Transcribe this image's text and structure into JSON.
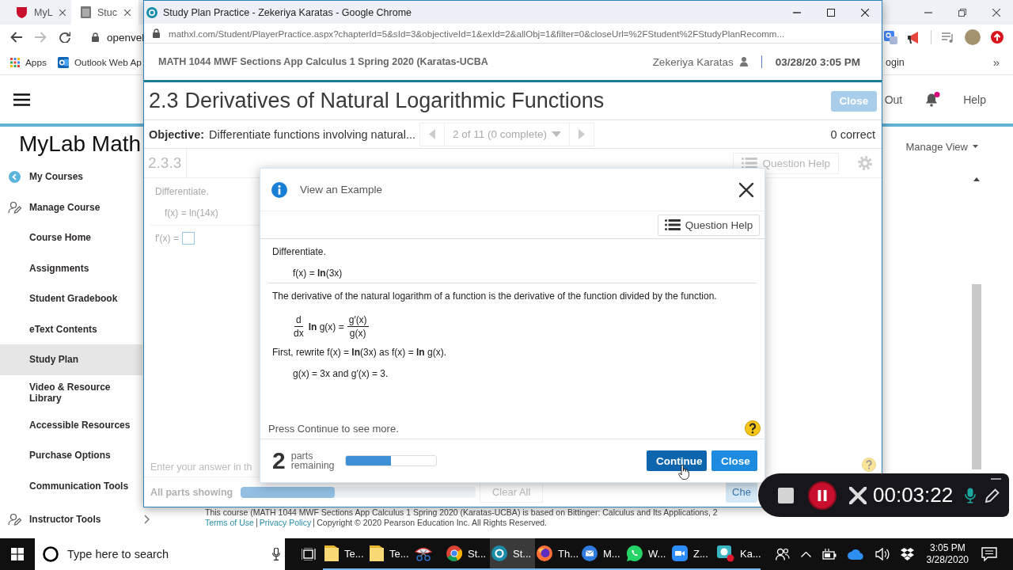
{
  "browser": {
    "tabs": [
      {
        "kind": "shield",
        "label": "MyL",
        "selected": false
      },
      {
        "kind": "page",
        "label": "Stuc",
        "selected": true
      }
    ],
    "address": "openvel",
    "bookmarks": [
      {
        "kind": "apps",
        "label": "Apps"
      },
      {
        "kind": "mail",
        "label": "Outlook Web Ap"
      }
    ],
    "bookmarks_right": [
      {
        "label": "ogin"
      }
    ],
    "overflow": "»"
  },
  "mylab": {
    "header_items": [
      {
        "kind": "link",
        "label": "Out"
      },
      {
        "kind": "bell"
      },
      {
        "kind": "link",
        "label": "Help"
      }
    ],
    "brand": "MyLab Math",
    "sidebar": [
      {
        "kind": "back",
        "label": "My Courses",
        "selected": false
      },
      {
        "kind": "tool",
        "label": "Manage Course",
        "selected": false
      },
      {
        "kind": "link",
        "label": "Course Home",
        "selected": false
      },
      {
        "kind": "link",
        "label": "Assignments",
        "selected": false
      },
      {
        "kind": "link",
        "label": "Student Gradebook",
        "selected": false
      },
      {
        "kind": "link",
        "label": "eText Contents",
        "selected": false
      },
      {
        "kind": "link",
        "label": "Study Plan",
        "selected": true
      },
      {
        "kind": "link",
        "label": "Video & Resource Library",
        "selected": false
      },
      {
        "kind": "link",
        "label": "Accessible Resources",
        "selected": false
      },
      {
        "kind": "link",
        "label": "Purchase Options",
        "selected": false
      },
      {
        "kind": "link",
        "label": "Communication Tools",
        "selected": false
      },
      {
        "kind": "tool_menu",
        "label": "Instructor Tools",
        "selected": false
      }
    ],
    "manage_view": "Manage View",
    "footer": {
      "note": "This course (MATH 1044 MWF Sections App Calculus 1 Spring 2020 (Karatas-UCBA) is based on Bittinger: Calculus and Its Applications, 2",
      "links": [
        "Terms of Use",
        "Privacy Policy"
      ],
      "copyright": "Copyright © 2020 Pearson Education Inc. All Rights Reserved."
    }
  },
  "popup": {
    "title": "Study Plan Practice - Zekeriya Karatas - Google Chrome",
    "url": "mathxl.com/Student/PlayerPractice.aspx?chapterId=5&sId=3&objectiveId=1&exId=2&allObj=1&filter=0&closeUrl=%2FStudent%2FStudyPlanRecomm...",
    "course": "MATH 1044 MWF Sections App Calculus 1 Spring 2020 (Karatas-UCBA",
    "user": "Zekeriya Karatas",
    "datetime": "03/28/20 3:05 PM",
    "section_number": "2.3",
    "section_title": "Derivatives of Natural Logarithmic Functions",
    "close_button": "Close",
    "objective_label": "Objective:",
    "objective": "Differentiate functions involving natural...",
    "question_position": "2 of 11 (0 complete)",
    "score": "0 correct",
    "question_number": "2.3.3",
    "question_help": "Question Help",
    "question": {
      "prompt": "Differentiate.",
      "function": "f(x) = ln(14x)",
      "answer_label": "f′(x) ="
    },
    "instructions": "Enter your answer in th",
    "parts": {
      "label": "All parts showing",
      "level": 0.4
    },
    "clear_button": "Clear All",
    "check_button": "Che"
  },
  "dialog": {
    "title": "View an Example",
    "question_help": "Question Help",
    "problem": {
      "prompt": "Differentiate.",
      "function": "f(x) = **ln**(3x)"
    },
    "steps": [
      {
        "kind": "text",
        "text": "The derivative of the natural logarithm of a function is the derivative of the function divided by the function."
      },
      {
        "kind": "fraction",
        "lhs_numerator": "d",
        "lhs_denominator": "dx",
        "middle": "**ln** g(x) =",
        "rhs_numerator": "g′(x)",
        "rhs_denominator": "g(x)"
      },
      {
        "kind": "text",
        "text": "First, rewrite f(x) = **ln**(3x) as f(x) = **ln** g(x)."
      },
      {
        "kind": "indented",
        "text": "g(x) = 3x and g′(x) = 3."
      }
    ],
    "hint": "Press Continue to see more.",
    "parts_count": "2",
    "parts_label": "parts remaining",
    "progress": {
      "level": 0.5
    },
    "buttons": [
      {
        "kind": "primary",
        "label": "Continue"
      },
      {
        "kind": "secondary",
        "label": "Close"
      }
    ]
  },
  "recorder": {
    "time": "00:03:22"
  },
  "taskbar": {
    "search": {
      "placeholder": "Type here to search"
    },
    "apps": [
      {
        "kind": "folder",
        "label": "Te...",
        "selected": false
      },
      {
        "kind": "folder",
        "label": "Te...",
        "selected": false
      },
      {
        "kind": "scissors",
        "selected": false
      },
      {
        "kind": "browser",
        "label": "St...",
        "selected": false
      },
      {
        "kind": "logo",
        "label": "St...",
        "selected": true
      },
      {
        "kind": "fox",
        "label": "Th...",
        "selected": false
      },
      {
        "kind": "mail",
        "label": "M...",
        "selected": false
      },
      {
        "kind": "chat",
        "label": "W...",
        "selected": false
      },
      {
        "kind": "video",
        "label": "Z...",
        "selected": false
      },
      {
        "kind": "recorder",
        "label": "Ka...",
        "selected": false
      }
    ],
    "clock": {
      "time": "3:05 PM",
      "date": "3/28/2020"
    }
  }
}
